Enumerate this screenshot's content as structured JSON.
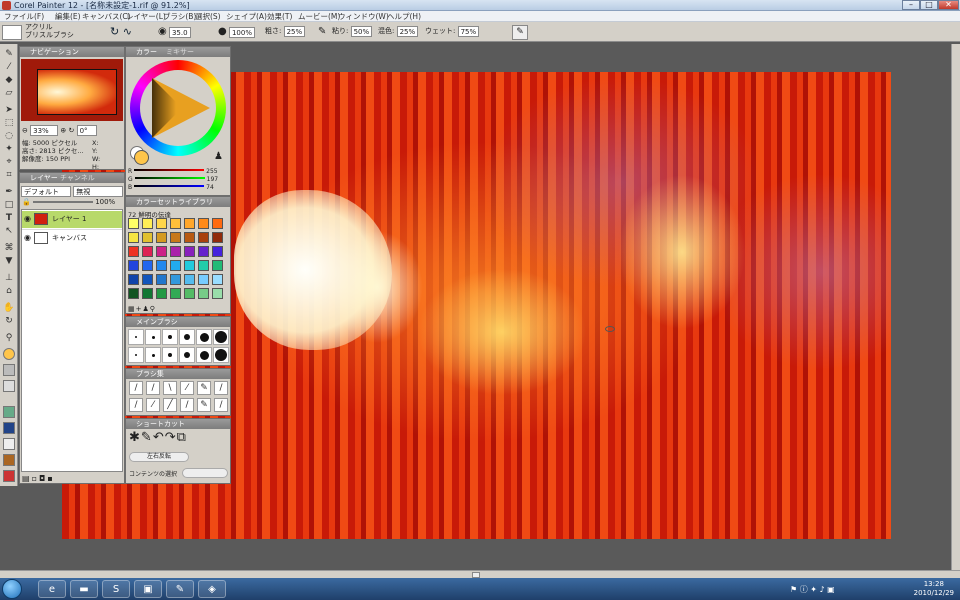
{
  "window": {
    "title": "Corel Painter 12 - [名称未設定-1.rif @ 91.2%]"
  },
  "menu": [
    "ファイル(F)",
    "編集(E)",
    "キャンバス(C)",
    "レイヤー(L)",
    "ブラシ(B)",
    "選択(S)",
    "シェイプ(A)",
    "効果(T)",
    "ムービー(M)",
    "ウィンドウ(W)",
    "ヘルプ(H)"
  ],
  "propbar": {
    "brush_category": "アクリル",
    "brush_variant": "ブリスルブラシ",
    "size_value": "35.0",
    "opacity_value": "100%",
    "thickness_label": "粗さ:",
    "thickness_value": "25%",
    "grain_label": "粘り:",
    "grain_value": "50%",
    "resat_label": "混色:",
    "resat_value": "25%",
    "wet_label": "ウェット:",
    "wet_value": "75%"
  },
  "navigator": {
    "title": "ナビゲーション",
    "zoom": "33%",
    "rotate": "0°",
    "info": [
      "幅: 5000 ピクセル",
      "高さ: 2813 ピクセ...",
      "解像度: 150 PPI"
    ],
    "x_label": "X:",
    "y_label": "Y:",
    "w_label": "W:",
    "h_label": "H:"
  },
  "color": {
    "tab1": "カラー",
    "tab2": "ミキサー",
    "r_label": "R",
    "r_value": "255",
    "g_label": "G",
    "g_value": "197",
    "b_label": "B",
    "b_value": "74",
    "main_color": "#ffc54a"
  },
  "layers": {
    "tab1": "レイヤー",
    "tab2": "チャンネル",
    "composite": "デフォルト",
    "composite2": "無視",
    "opacity": "100%",
    "items": [
      {
        "name": "レイヤー 1"
      },
      {
        "name": "キャンバス"
      }
    ]
  },
  "library": {
    "title": "カラーセットライブラリ",
    "set_name": "72 鮮明の伝達",
    "swatches": [
      "#ffff66",
      "#ffee55",
      "#ffd64a",
      "#ffbf3a",
      "#ffa62a",
      "#ff8a1a",
      "#ff6a10",
      "#f5e542",
      "#e0c030",
      "#d49a20",
      "#c8781a",
      "#b85a12",
      "#a8400e",
      "#902a0a",
      "#ee3322",
      "#dd2255",
      "#cc2288",
      "#aa22aa",
      "#8822bb",
      "#6622cc",
      "#4422dd",
      "#2244dd",
      "#2266ee",
      "#2288ee",
      "#22aaee",
      "#22ccdd",
      "#22ccaa",
      "#22bb77",
      "#1144aa",
      "#1155bb",
      "#2277cc",
      "#3399dd",
      "#55bbee",
      "#77ccff",
      "#99ddff",
      "#115522",
      "#117733",
      "#229944",
      "#33aa55",
      "#55bb66",
      "#77cc88",
      "#99ddaa"
    ]
  },
  "brush_dock": {
    "title": "メインブラシ"
  },
  "brush_tools": {
    "title": "ブラシ集"
  },
  "shortcuts": {
    "title": "ショートカット",
    "btn1": "左右反転",
    "btn2": "コンテンツの選択"
  },
  "taskbar": {
    "time": "13:28",
    "date": "2010/12/29"
  }
}
